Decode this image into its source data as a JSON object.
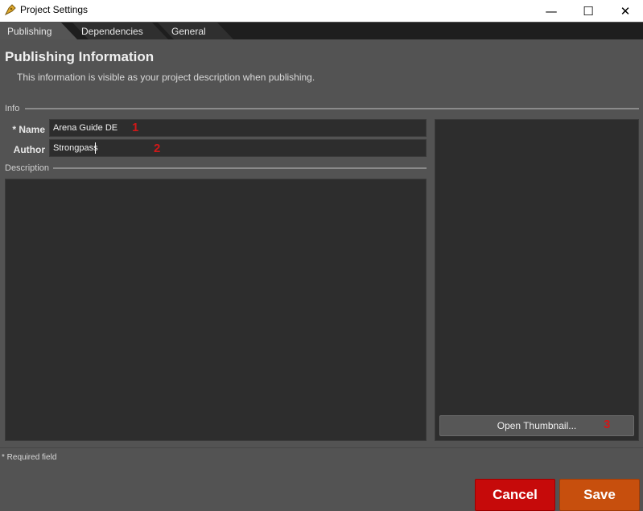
{
  "window": {
    "title": "Project Settings",
    "icon": "pen-nib-icon",
    "controls": {
      "minimize": "—",
      "maximize": "☐",
      "close": "✕"
    }
  },
  "tabs": [
    {
      "label": "Publishing",
      "active": true
    },
    {
      "label": "Dependencies",
      "active": false
    },
    {
      "label": "General",
      "active": false
    }
  ],
  "header": {
    "title": "Publishing Information",
    "subtitle": "This information is visible as your project description when publishing."
  },
  "info": {
    "section_label": "Info",
    "name_label": "* Name",
    "name_value": "Arena Guide DE",
    "author_label": "Author",
    "author_value": "Strongpass",
    "description_label": "Description",
    "description_value": ""
  },
  "thumbnail": {
    "button_label": "Open Thumbnail..."
  },
  "markers": [
    "1",
    "2",
    "3"
  ],
  "footer": {
    "required_note": "* Required field",
    "cancel_label": "Cancel",
    "save_label": "Save"
  },
  "colors": {
    "cancel": "#c60a0a",
    "save": "#c74f0d",
    "marker": "#d01818",
    "background": "#535353",
    "field": "#2d2d2d"
  }
}
